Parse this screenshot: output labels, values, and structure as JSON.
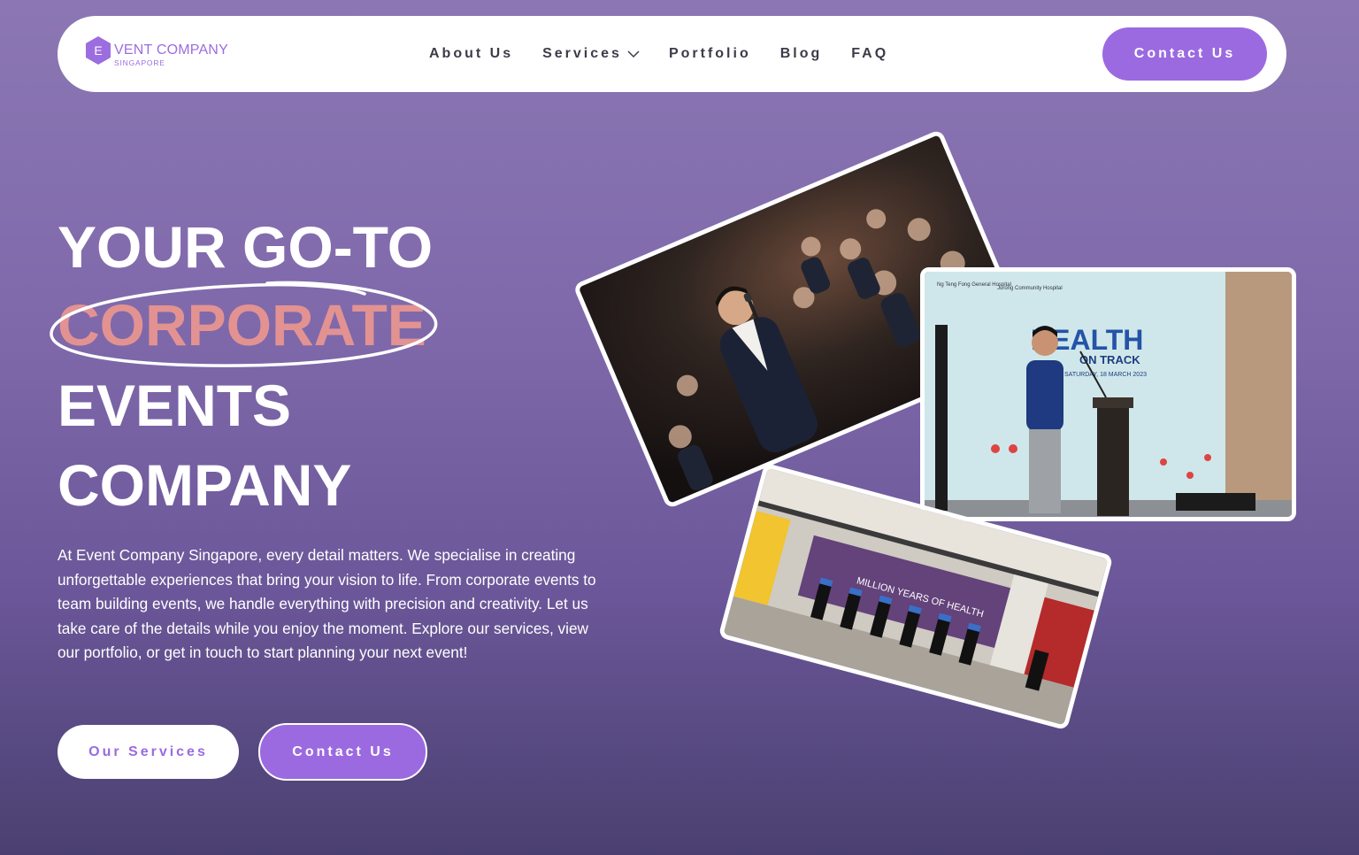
{
  "brand": {
    "logo_letter": "E",
    "name": "VENT COMPANY",
    "sub": "SINGAPORE",
    "color": "#9c6de0"
  },
  "nav": {
    "items": [
      {
        "label": "About Us"
      },
      {
        "label": "Services",
        "icon": "chevron-down-icon"
      },
      {
        "label": "Portfolio"
      },
      {
        "label": "Blog"
      },
      {
        "label": "FAQ"
      }
    ],
    "cta": "Contact Us"
  },
  "hero": {
    "line1": "YOUR GO-TO",
    "line2": "CORPORATE",
    "line3": "EVENTS",
    "line4": "COMPANY",
    "paragraph": "At Event Company Singapore, every detail matters. We specialise in creating unforgettable experiences that bring your vision to life. From corporate events to team building events, we handle everything with precision and creativity. Let us take care of the details while you enjoy the moment. Explore our services, view our portfolio, or get in touch to start planning your next event!",
    "btn_services": "Our Services",
    "btn_contact": "Contact Us",
    "accent_color": "#e39292"
  },
  "photos": {
    "stage_banner": {
      "hospital1": "Ng Teng Fong General Hospital",
      "hospital2": "Jurong Community Hospital",
      "title": "HEALTH",
      "subtitle": "ON TRACK",
      "date": "SATURDAY, 18 MARCH 2023"
    },
    "expo_banner": {
      "title": "MILLION YEARS OF HEALTH"
    }
  },
  "colors": {
    "primary": "#9b6ae0",
    "bg_top": "#8c77b4",
    "bg_bottom": "#4a4070",
    "nav_text": "#3f3a48"
  }
}
